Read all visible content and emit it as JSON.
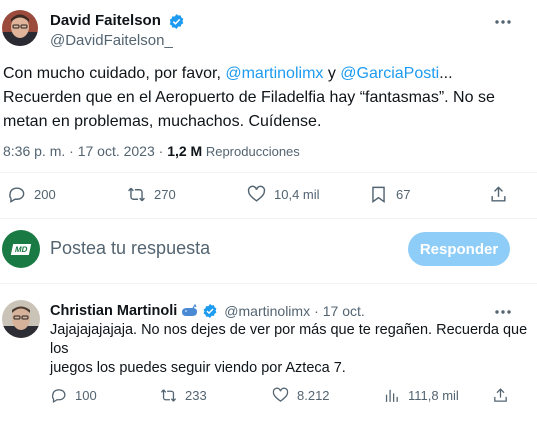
{
  "tweet": {
    "author_name": "David Faitelson",
    "author_handle": "@DavidFaitelson_",
    "text_prefix": "Con mucho cuidado, por favor, ",
    "mention1": "@martinolimx",
    "text_mid": " y ",
    "mention2": "@GarciaPosti",
    "ellipsis": "...",
    "line2": "Recuerden que en el Aeropuerto de Filadelfia hay “fantasmas”. No se",
    "line3": "metan en problemas, muchachos. Cuídense.",
    "time": "8:36 p. m. · 17 oct. 2023 · ",
    "views_count": "1,2 M",
    "views_label": " Reproducciones",
    "replies": "200",
    "retweets": "270",
    "likes": "10,4 mil",
    "bookmarks": "67"
  },
  "composer": {
    "placeholder": "Postea tu respuesta",
    "button_label": "Responder",
    "avatar_text": "MD"
  },
  "reply": {
    "author_name": "Christian Martinoli",
    "author_handle": "@martinolimx",
    "separator": "·",
    "date": "17 oct.",
    "line1": "Jajajajajajaja. No nos dejes de ver por más que te regañen. Recuerda que",
    "line2": "los",
    "line3": "juegos los puedes seguir viendo por Azteca 7.",
    "replies": "100",
    "retweets": "233",
    "likes": "8.212",
    "views": "111,8 mil"
  },
  "colors": {
    "accent": "#1d9bf0",
    "verified": "#1d9bf0",
    "reply_button": "#8ecdf8"
  }
}
